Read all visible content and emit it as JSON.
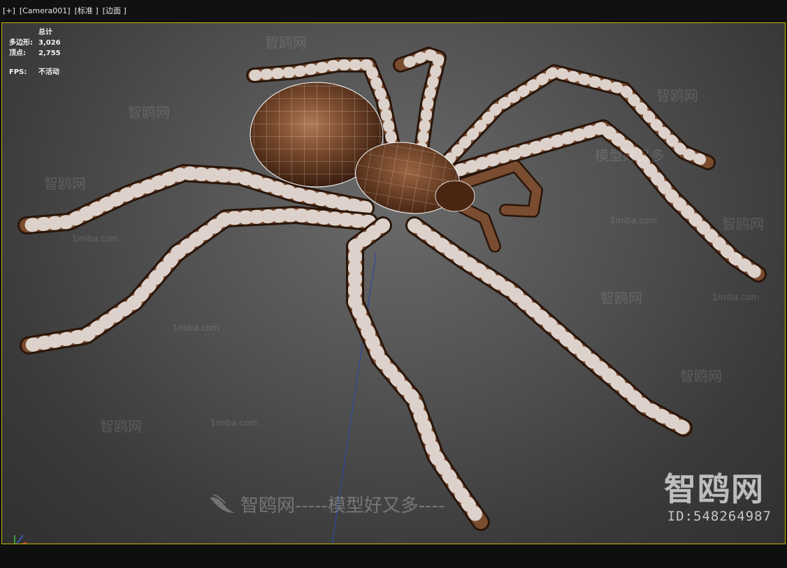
{
  "menubar": {
    "plus": "[+]",
    "camera": "[Camera001]",
    "shading": "[标准 ]",
    "mode": "[边面 ]"
  },
  "stats": {
    "title": "总计",
    "polys_label": "多边形:",
    "polys_value": "3,026",
    "verts_label": "顶点:",
    "verts_value": "2,755",
    "fps_label": "FPS:",
    "fps_value": "不活动"
  },
  "watermark": {
    "brand": "智鸥网",
    "site": "1miba.com",
    "slogan": "智鸥网-----模型好又多----",
    "model_char": "模型好又多",
    "id": "ID:548264987"
  },
  "colors": {
    "frame": "#c8b400",
    "spider_body": "#6e3e22",
    "wire": "#ffffff"
  }
}
